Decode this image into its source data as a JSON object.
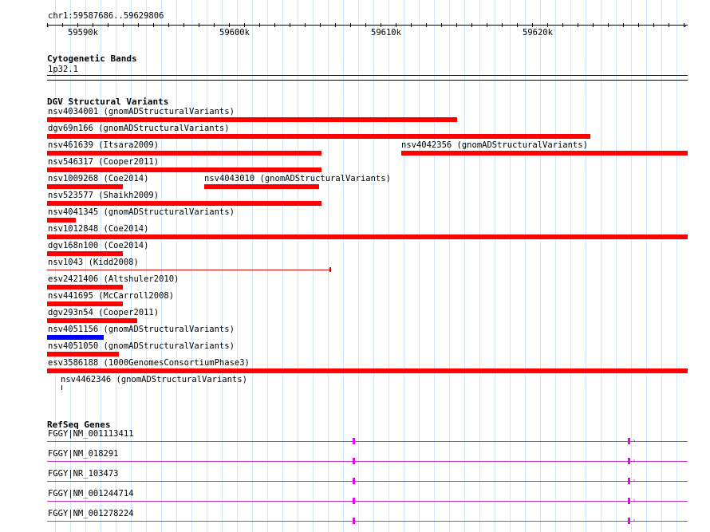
{
  "ruler": {
    "position_label": "chr1:59587686..59629806",
    "ticks": [
      "59590k",
      "59600k",
      "59610k",
      "59620k"
    ]
  },
  "cytobands": {
    "title": "Cytogenetic Bands",
    "band": "1p32.1"
  },
  "dgv": {
    "title": "DGV Structural Variants",
    "colors": {
      "loss": "#ff0000",
      "gain": "#0000ff",
      "thin": "#cc0000"
    },
    "rows": [
      [
        {
          "label": "nsv4034001 (gnomADStructuralVariants)",
          "type": "loss"
        }
      ],
      [
        {
          "label": "dgv69n166 (gnomADStructuralVariants)",
          "type": "loss"
        }
      ],
      [
        {
          "label": "nsv461639 (Itsara2009)",
          "type": "loss"
        },
        {
          "label": "nsv4042356 (gnomADStructuralVariants)",
          "type": "loss"
        }
      ],
      [
        {
          "label": "nsv546317 (Cooper2011)",
          "type": "loss"
        }
      ],
      [
        {
          "label": "nsv1009268 (Coe2014)",
          "type": "loss"
        },
        {
          "label": "nsv4043010 (gnomADStructuralVariants)",
          "type": "loss"
        }
      ],
      [
        {
          "label": "nsv523577 (Shaikh2009)",
          "type": "loss"
        }
      ],
      [
        {
          "label": "nsv4041345 (gnomADStructuralVariants)",
          "type": "loss"
        }
      ],
      [
        {
          "label": "nsv1012848 (Coe2014)",
          "type": "loss"
        }
      ],
      [
        {
          "label": "dgv168n100 (Coe2014)",
          "type": "loss"
        }
      ],
      [
        {
          "label": "nsv1043 (Kidd2008)",
          "type": "thin"
        }
      ],
      [
        {
          "label": "esv2421406 (Altshuler2010)",
          "type": "loss"
        }
      ],
      [
        {
          "label": "nsv441695 (McCarroll2008)",
          "type": "loss"
        }
      ],
      [
        {
          "label": "dgv293n54 (Cooper2011)",
          "type": "loss"
        }
      ],
      [
        {
          "label": "nsv4051156 (gnomADStructuralVariants)",
          "type": "gain"
        }
      ],
      [
        {
          "label": "nsv4051050 (gnomADStructuralVariants)",
          "type": "loss"
        }
      ],
      [
        {
          "label": "esv3586188 (1000GenomesConsortiumPhase3)",
          "type": "loss"
        }
      ],
      [
        {
          "label": "nsv4462346 (gnomADStructuralVariants)",
          "type": "tick"
        }
      ]
    ]
  },
  "refseq": {
    "title": "RefSeq Genes",
    "color": "#cc33cc",
    "exon_color": "#ee00ee",
    "genes": [
      "FGGY|NM_001113411",
      "FGGY|NM_018291",
      "FGGY|NR_103473",
      "FGGY|NM_001244714",
      "FGGY|NM_001278224"
    ]
  }
}
